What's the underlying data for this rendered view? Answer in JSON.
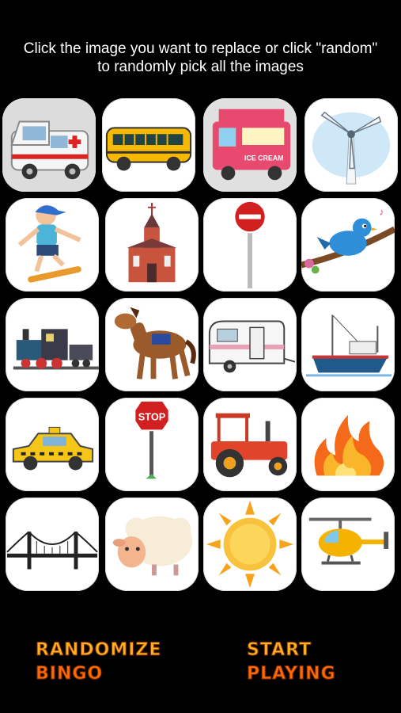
{
  "instructions": {
    "line1": "Click the image you want to replace or click \"random\"",
    "line2": "to randomly pick all the images"
  },
  "tiles": [
    {
      "icon": "ambulance-icon"
    },
    {
      "icon": "school-bus-icon"
    },
    {
      "icon": "ice-cream-truck-icon"
    },
    {
      "icon": "wind-turbine-icon"
    },
    {
      "icon": "skateboarder-icon"
    },
    {
      "icon": "church-icon"
    },
    {
      "icon": "no-entry-sign-icon"
    },
    {
      "icon": "bird-on-branch-icon"
    },
    {
      "icon": "steam-train-icon"
    },
    {
      "icon": "horse-icon"
    },
    {
      "icon": "camper-trailer-icon"
    },
    {
      "icon": "boat-icon"
    },
    {
      "icon": "taxi-icon"
    },
    {
      "icon": "stop-sign-icon"
    },
    {
      "icon": "tractor-icon"
    },
    {
      "icon": "fire-icon"
    },
    {
      "icon": "bridge-icon"
    },
    {
      "icon": "sheep-icon"
    },
    {
      "icon": "sun-icon"
    },
    {
      "icon": "helicopter-icon"
    }
  ],
  "labels": {
    "ice_cream": "ICE CREAM",
    "stop": "STOP"
  },
  "buttons": {
    "randomize": {
      "line1": "RANDOMIZE",
      "line2": "BINGO"
    },
    "start": {
      "line1": "START",
      "line2": "PLAYING"
    }
  },
  "colors": {
    "background": "#000000",
    "button_top": "#ffb020",
    "button_bottom": "#ff6a00"
  }
}
